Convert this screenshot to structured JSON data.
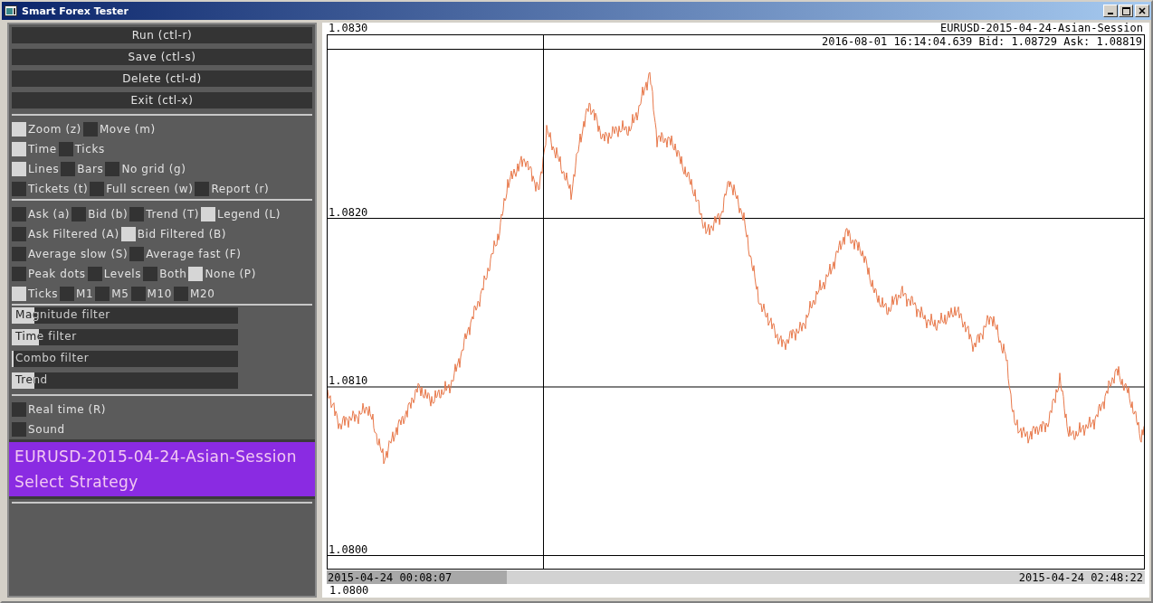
{
  "window": {
    "title": "Smart Forex Tester"
  },
  "buttons": [
    {
      "label": "Run (ctl-r)"
    },
    {
      "label": "Save (ctl-s)"
    },
    {
      "label": "Delete (ctl-d)"
    },
    {
      "label": "Exit (ctl-x)"
    }
  ],
  "option_groups": [
    {
      "rows": [
        [
          {
            "label": "Zoom (z)",
            "checked": true
          },
          {
            "label": "Move (m)",
            "checked": false
          }
        ],
        [
          {
            "label": "Time",
            "checked": true
          },
          {
            "label": "Ticks",
            "checked": false
          }
        ],
        [
          {
            "label": "Lines",
            "checked": true
          },
          {
            "label": "Bars",
            "checked": false
          },
          {
            "label": "No grid (g)",
            "checked": false
          }
        ],
        [
          {
            "label": "Tickets (t)",
            "checked": false
          },
          {
            "label": "Full screen (w)",
            "checked": false
          },
          {
            "label": "Report (r)",
            "checked": false
          }
        ]
      ]
    },
    {
      "rows": [
        [
          {
            "label": "Ask (a)",
            "checked": false
          },
          {
            "label": "Bid (b)",
            "checked": false
          },
          {
            "label": "Trend (T)",
            "checked": false
          },
          {
            "label": "Legend (L)",
            "checked": true
          }
        ],
        [
          {
            "label": "Ask Filtered (A)",
            "checked": false
          },
          {
            "label": "Bid Filtered (B)",
            "checked": true
          }
        ],
        [
          {
            "label": "Average slow (S)",
            "checked": false
          },
          {
            "label": "Average fast (F)",
            "checked": false
          }
        ],
        [
          {
            "label": "Peak dots",
            "checked": false
          },
          {
            "label": "Levels",
            "checked": false
          },
          {
            "label": "Both",
            "checked": false
          },
          {
            "label": "None (P)",
            "checked": true
          }
        ],
        [
          {
            "label": "Ticks",
            "checked": true
          },
          {
            "label": "M1",
            "checked": false
          },
          {
            "label": "M5",
            "checked": false
          },
          {
            "label": "M10",
            "checked": false
          },
          {
            "label": "M20",
            "checked": false
          }
        ]
      ]
    }
  ],
  "filters": [
    {
      "label": "Magnitude filter",
      "level": 0.1
    },
    {
      "label": "Time filter",
      "level": 0.12
    },
    {
      "label": "Combo filter",
      "level": 0.008
    },
    {
      "label": "Trend",
      "level": 0.1
    }
  ],
  "toggles": [
    {
      "label": "Real time (R)",
      "checked": false
    },
    {
      "label": "Sound",
      "checked": false
    }
  ],
  "session_panel": {
    "title": "EURUSD-2015-04-24-Asian-Session",
    "subtitle": "Select Strategy"
  },
  "chart": {
    "instrument": "EURUSD-2015-04-24-Asian-Session",
    "quote": "2016-08-01 16:14:04.639 Bid: 1.08729 Ask: 1.08819",
    "y_labels": [
      "1.0830",
      "1.0820",
      "1.0810",
      "1.0800"
    ],
    "time_range": {
      "start": "2015-04-24 00:08:07",
      "end": "2015-04-24 02:48:22",
      "level": 0.22
    },
    "footer_value": "1.0800"
  }
}
